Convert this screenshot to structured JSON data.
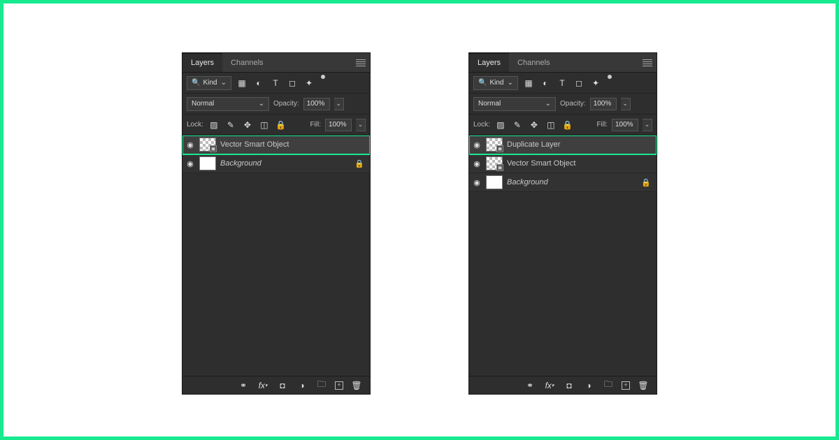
{
  "highlight_color": "#17e98f",
  "panels": [
    {
      "tabs": {
        "active": "Layers",
        "inactive": "Channels"
      },
      "filter": {
        "label": "Kind"
      },
      "blend": {
        "mode": "Normal",
        "opacity_label": "Opacity:",
        "opacity_value": "100%"
      },
      "lock": {
        "label": "Lock:",
        "fill_label": "Fill:",
        "fill_value": "100%"
      },
      "layers": [
        {
          "name": "Vector Smart Object",
          "thumb": "transparent",
          "smart": true,
          "selected": true,
          "highlighted": true,
          "locked": false,
          "italic": false
        },
        {
          "name": "Background",
          "thumb": "white",
          "smart": false,
          "selected": false,
          "highlighted": false,
          "locked": true,
          "italic": true
        }
      ]
    },
    {
      "tabs": {
        "active": "Layers",
        "inactive": "Channels"
      },
      "filter": {
        "label": "Kind"
      },
      "blend": {
        "mode": "Normal",
        "opacity_label": "Opacity:",
        "opacity_value": "100%"
      },
      "lock": {
        "label": "Lock:",
        "fill_label": "Fill:",
        "fill_value": "100%"
      },
      "layers": [
        {
          "name": "Duplicate Layer",
          "thumb": "transparent",
          "smart": true,
          "selected": true,
          "highlighted": true,
          "locked": false,
          "italic": false
        },
        {
          "name": "Vector Smart Object",
          "thumb": "transparent",
          "smart": true,
          "selected": false,
          "highlighted": false,
          "locked": false,
          "italic": false
        },
        {
          "name": "Background",
          "thumb": "white",
          "smart": false,
          "selected": false,
          "highlighted": false,
          "locked": true,
          "italic": true
        }
      ]
    }
  ]
}
